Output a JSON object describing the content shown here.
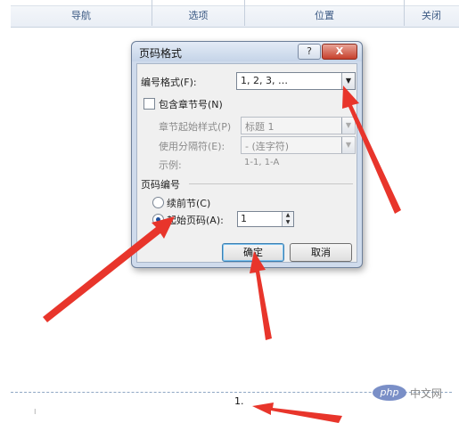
{
  "ribbon": {
    "groups": [
      {
        "label": "导航"
      },
      {
        "label": "选项"
      },
      {
        "label": "位置"
      },
      {
        "label": "关闭"
      }
    ]
  },
  "dialog": {
    "title": "页码格式",
    "help_label": "?",
    "close_label": "X",
    "number_format": {
      "label": "编号格式(F):",
      "value": "1, 2, 3, …"
    },
    "include_chapter": {
      "label": "包含章节号(N)",
      "checked": false
    },
    "chapter_style": {
      "label": "章节起始样式(P)",
      "value": "标题 1"
    },
    "separator": {
      "label": "使用分隔符(E):",
      "value": "-   (连字符)"
    },
    "example": {
      "label": "示例:",
      "value": "1-1, 1-A"
    },
    "page_numbering": {
      "group_label": "页码编号",
      "continue_label": "续前节(C)",
      "start_label": "起始页码(A):",
      "start_value": "1",
      "selected": "start"
    },
    "ok_label": "确定",
    "cancel_label": "取消"
  },
  "document": {
    "page_number_text": "1.",
    "tiny_mark": "⁝"
  },
  "watermark": {
    "logo": "php",
    "text": "中文网"
  },
  "colors": {
    "arrow": "#e8352b",
    "accent": "#1e4f9c"
  }
}
